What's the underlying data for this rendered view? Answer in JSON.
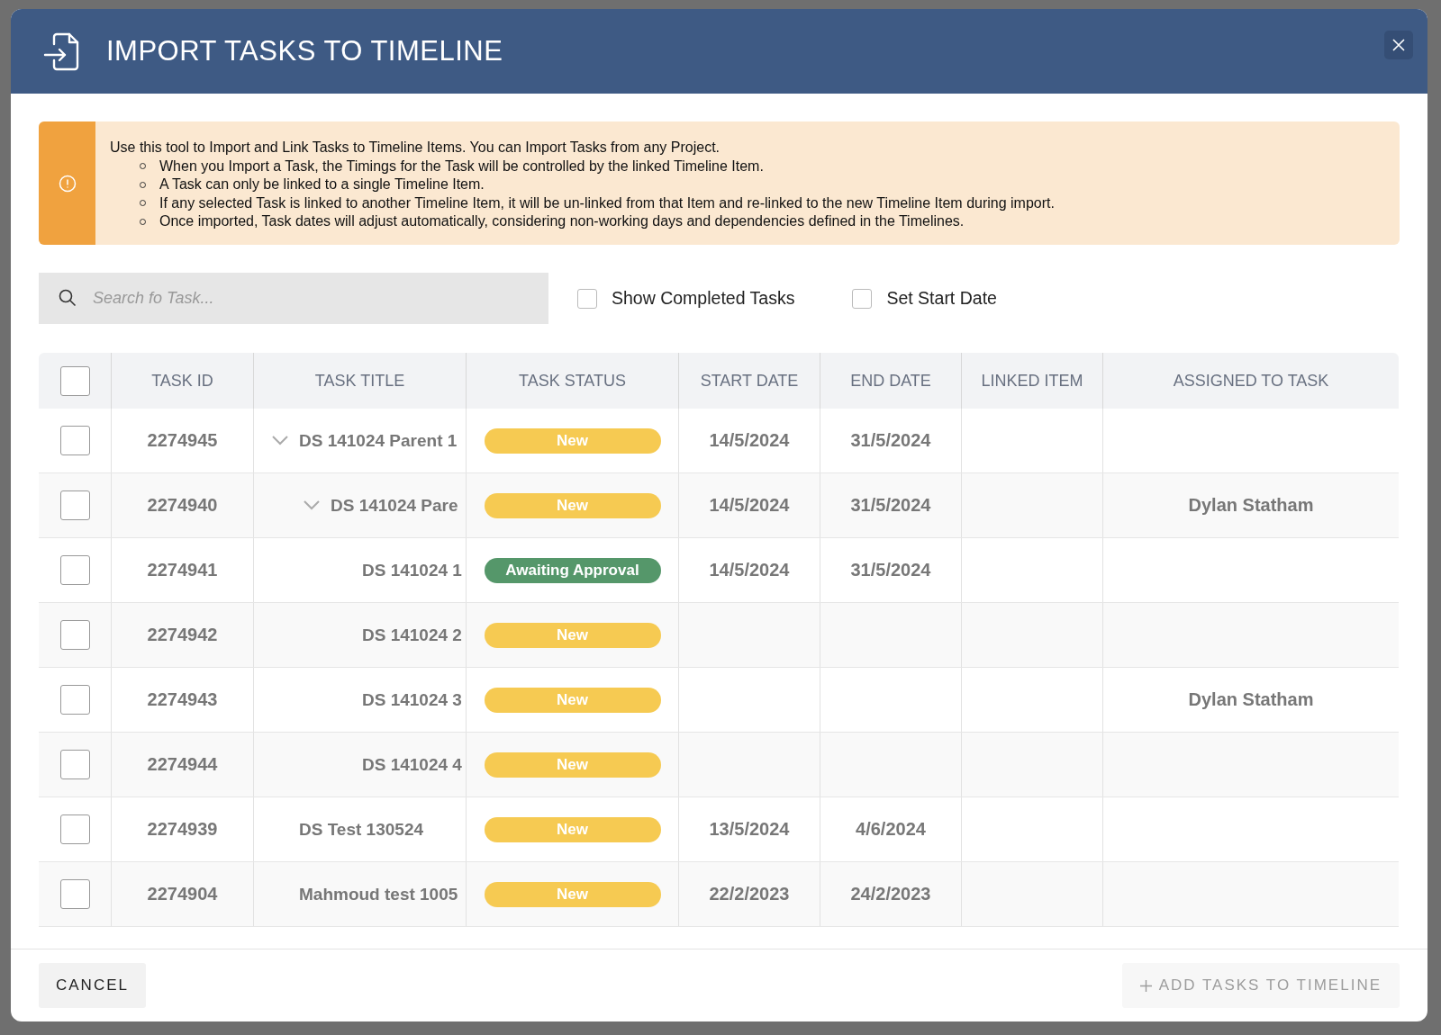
{
  "dialog": {
    "title": "IMPORT TASKS TO TIMELINE"
  },
  "notice": {
    "intro": "Use this tool to Import and Link Tasks to Timeline Items. You can Import Tasks from any Project.",
    "bullets": [
      "When you Import a Task, the Timings for the Task will be controlled by the linked Timeline Item.",
      "A Task can only be linked to a single Timeline Item.",
      "If any selected Task is linked to another Timeline Item, it will be un-linked from that Item and re-linked to the new Timeline Item during import.",
      "Once imported, Task dates will adjust automatically, considering non-working days and dependencies defined in the Timelines."
    ]
  },
  "search": {
    "placeholder": "Search fo Task..."
  },
  "filters": [
    {
      "label": "Show Completed Tasks",
      "checked": false
    },
    {
      "label": "Set Start Date",
      "checked": false
    }
  ],
  "table": {
    "select_all": {
      "checked": false
    },
    "columns": [
      "TASK ID",
      "TASK TITLE",
      "TASK STATUS",
      "START DATE",
      "END DATE",
      "LINKED ITEM",
      "ASSIGNED TO TASK"
    ],
    "rows": [
      {
        "id": "2274945",
        "title": "DS 141024 Parent 1",
        "status": "New",
        "color": "#f6ca52",
        "start": "14/5/2024",
        "end": "31/5/2024",
        "checked": false,
        "expanded": true,
        "children": [
          {
            "id": "2274940",
            "title": "DS 141024 Pare",
            "status": "New",
            "color": "#f6ca52",
            "start": "14/5/2024",
            "end": "31/5/2024",
            "assigned": "Dylan Statham",
            "checked": false,
            "expanded": true,
            "children": [
              {
                "id": "2274941",
                "title": "DS 141024 1",
                "status": "Awaiting Approval",
                "color": "#55976a",
                "start": "14/5/2024",
                "end": "31/5/2024",
                "checked": false
              },
              {
                "id": "2274942",
                "title": "DS 141024 2",
                "status": "New",
                "color": "#f6ca52",
                "checked": false
              },
              {
                "id": "2274943",
                "title": "DS 141024 3",
                "status": "New",
                "color": "#f6ca52",
                "assigned": "Dylan Statham",
                "checked": false
              },
              {
                "id": "2274944",
                "title": "DS 141024 4",
                "status": "New",
                "color": "#f6ca52",
                "checked": false
              }
            ]
          }
        ]
      },
      {
        "id": "2274939",
        "title": "DS Test 130524",
        "status": "New",
        "color": "#f6ca52",
        "start": "13/5/2024",
        "end": "4/6/2024",
        "checked": false
      },
      {
        "id": "2274904",
        "title": "Mahmoud test 1005",
        "status": "New",
        "color": "#f6ca52",
        "start": "22/2/2023",
        "end": "24/2/2023",
        "checked": false
      }
    ]
  },
  "footer": {
    "cancel": "CANCEL",
    "submit": {
      "label": "ADD TASKS TO TIMELINE",
      "disabled": true
    }
  }
}
